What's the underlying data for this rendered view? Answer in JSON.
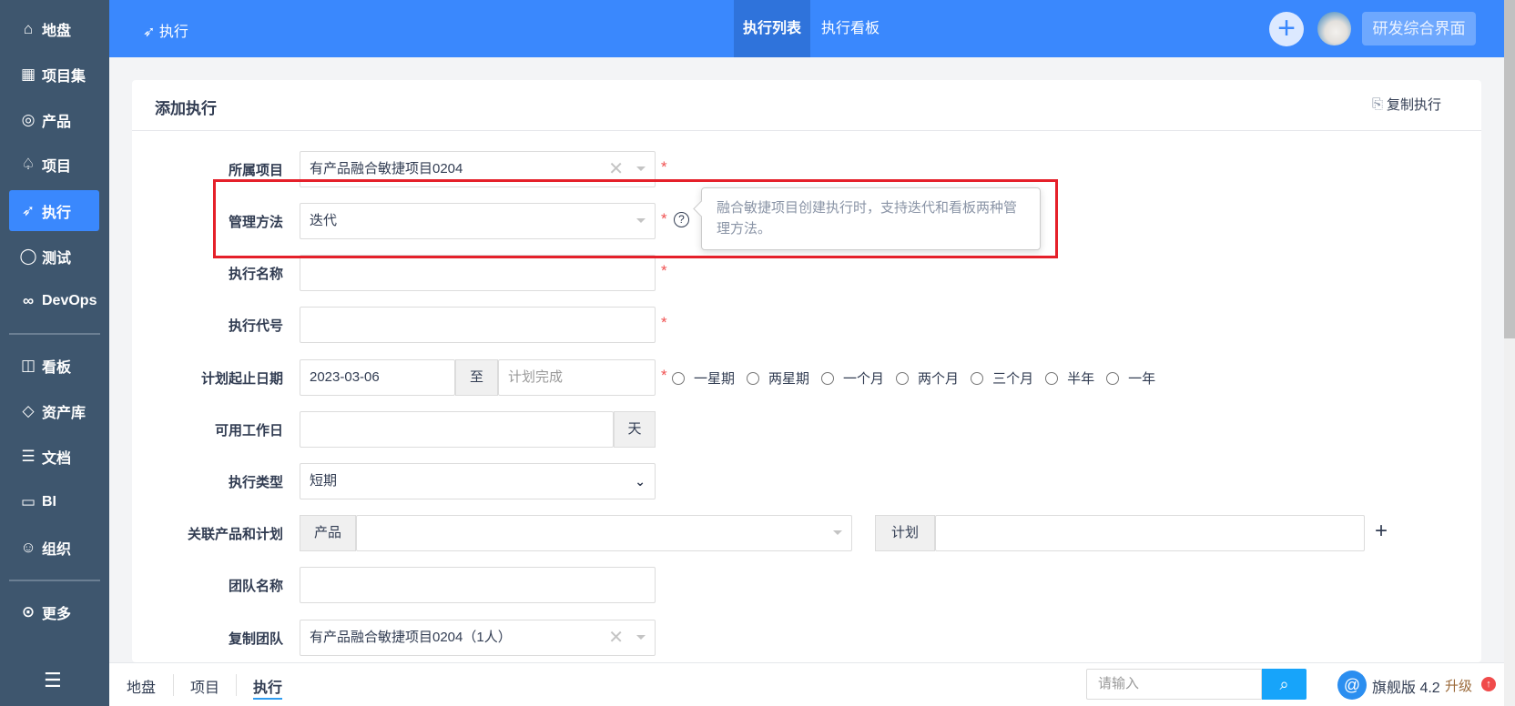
{
  "sidebar": {
    "items": [
      {
        "label": "地盘",
        "icon": "home-icon"
      },
      {
        "label": "项目集",
        "icon": "grid-icon"
      },
      {
        "label": "产品",
        "icon": "bulb-icon"
      },
      {
        "label": "项目",
        "icon": "rocket-icon"
      },
      {
        "label": "执行",
        "icon": "run-icon",
        "active": true
      },
      {
        "label": "测试",
        "icon": "test-icon"
      },
      {
        "label": "DevOps",
        "icon": "infinity-icon"
      },
      {
        "label": "看板",
        "icon": "kanban-icon"
      },
      {
        "label": "资产库",
        "icon": "diamond-icon"
      },
      {
        "label": "文档",
        "icon": "doc-icon"
      },
      {
        "label": "BI",
        "icon": "chart-icon"
      },
      {
        "label": "组织",
        "icon": "users-icon"
      },
      {
        "label": "更多",
        "icon": "more-icon"
      }
    ]
  },
  "header": {
    "title": "执行",
    "tabs": [
      "执行列表",
      "执行看板"
    ],
    "workspace_button": "研发综合界面"
  },
  "card": {
    "title": "添加执行",
    "copy_label": "复制执行"
  },
  "form": {
    "project": {
      "label": "所属项目",
      "value": "有产品融合敏捷项目0204"
    },
    "method": {
      "label": "管理方法",
      "value": "迭代",
      "tooltip": "融合敏捷项目创建执行时，支持迭代和看板两种管理方法。"
    },
    "name": {
      "label": "执行名称",
      "value": ""
    },
    "code": {
      "label": "执行代号",
      "value": ""
    },
    "dates": {
      "label": "计划起止日期",
      "begin": "2023-03-06",
      "to": "至",
      "end_placeholder": "计划完成",
      "options": [
        "一星期",
        "两星期",
        "一个月",
        "两个月",
        "三个月",
        "半年",
        "一年"
      ]
    },
    "days": {
      "label": "可用工作日",
      "unit": "天"
    },
    "type": {
      "label": "执行类型",
      "value": "短期"
    },
    "products": {
      "label": "关联产品和计划",
      "product_addon": "产品",
      "plan_addon": "计划"
    },
    "team": {
      "label": "团队名称",
      "value": ""
    },
    "copy_team": {
      "label": "复制团队",
      "value": "有产品融合敏捷项目0204（1人）"
    }
  },
  "bottom": {
    "tabs": [
      "地盘",
      "项目",
      "执行"
    ],
    "search_placeholder": "请输入",
    "version": "旗舰版 4.2",
    "upgrade": "升级"
  }
}
